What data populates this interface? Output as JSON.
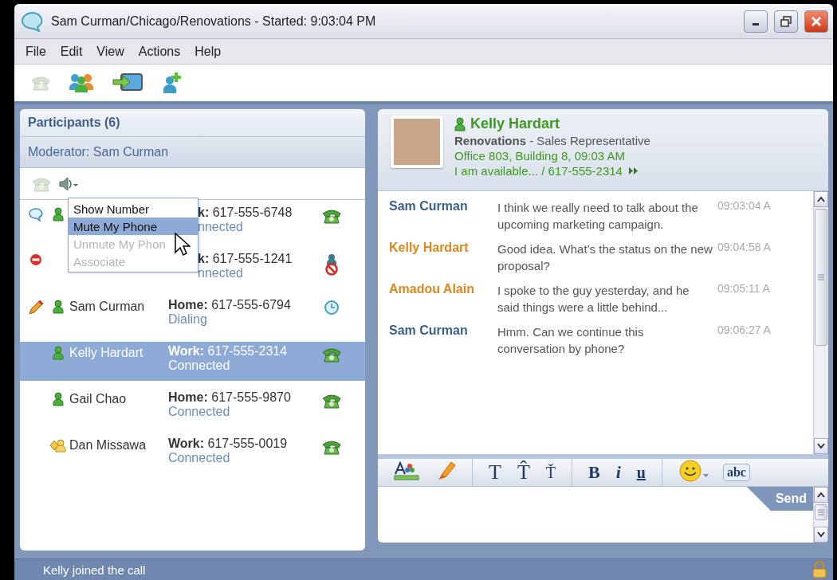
{
  "window": {
    "title": "Sam Curman/Chicago/Renovations - Started: 9:03:04 PM"
  },
  "menu_bar": [
    "File",
    "Edit",
    "View",
    "Actions",
    "Help"
  ],
  "toolbar": [
    {
      "kind": "phone",
      "disabled": true
    },
    {
      "kind": "group",
      "disabled": false
    },
    {
      "kind": "share",
      "disabled": false
    },
    {
      "kind": "add",
      "disabled": false
    }
  ],
  "participants": {
    "title": "Participants (6)",
    "moderator": "Moderator: Sam Curman",
    "rows": [
      {
        "badge": {
          "kind": "chat"
        },
        "presence": {
          "kind": "person"
        },
        "phone_label": "k:",
        "number": "617-555-6748",
        "status": "nnected",
        "call": {
          "kind": "connected"
        },
        "covered": true,
        "selected": false
      },
      {
        "badge": {
          "kind": "stop"
        },
        "phone_label": "k:",
        "number": "617-555-1241",
        "status": "nnected",
        "call": {
          "kind": "blocked"
        },
        "covered": true,
        "selected": false
      },
      {
        "badge": {
          "kind": "edit"
        },
        "presence": {
          "kind": "person"
        },
        "name": "Sam Curman",
        "phone_label": "Home:",
        "number": "617-555-6794",
        "status": "Dialing",
        "call": {
          "kind": "waiting"
        },
        "covered": false,
        "selected": false
      },
      {
        "presence": {
          "kind": "person"
        },
        "name": "Kelly Hardart",
        "phone_label": "Work:",
        "number": "617-555-2314",
        "status": "Connected",
        "call": {
          "kind": "connected"
        },
        "covered": false,
        "selected": true
      },
      {
        "presence": {
          "kind": "person"
        },
        "name": "Gail Chao",
        "phone_label": "Home:",
        "number": "617-555-9870",
        "status": "Connected",
        "call": {
          "kind": "connected"
        },
        "covered": false,
        "selected": false
      },
      {
        "presence": {
          "kind": "group"
        },
        "name": "Dan Missawa",
        "phone_label": "Work:",
        "number": "617-555-0019",
        "status": "Connected",
        "call": {
          "kind": "connected"
        },
        "covered": false,
        "selected": false
      }
    ],
    "menu": [
      {
        "label": "Show Number",
        "selected": false,
        "disabled": false
      },
      {
        "label": "Mute My Phone",
        "selected": true,
        "disabled": false
      },
      {
        "label": "Unmute My Phon",
        "selected": false,
        "disabled": true
      },
      {
        "label": "Associate",
        "selected": false,
        "disabled": true
      }
    ]
  },
  "contact": {
    "name": "Kelly Hardart",
    "title": "**Renovations** - Sales Representative",
    "location": "Office 803, Building 8, 09:03 AM",
    "availability": "I am available... / 617-555-2314"
  },
  "messages": [
    {
      "sender": "Sam Curman",
      "color": "#3b5f8e",
      "text": "I think we really need to talk about the upcoming marketing campaign.",
      "time": "09:03:04 A"
    },
    {
      "sender": "Kelly Hardart",
      "color": "#e0871c",
      "text": "Good idea. What’s the status on the new proposal?",
      "time": "09:04:58 A"
    },
    {
      "sender": "Amadou Alain",
      "color": "#e0871c",
      "text": "I spoke to the guy yesterday, and he said things were a little behind...",
      "time": "09:05:11 A"
    },
    {
      "sender": "Sam Curman",
      "color": "#3b5f8e",
      "text": "Hmm. Can we continue this conversation by phone?",
      "time": "09:06:27 A"
    }
  ],
  "format_tools": [
    {
      "kind": "color"
    },
    {
      "kind": "highlight"
    },
    {
      "kind": "separator"
    },
    {
      "kind": "text",
      "label": "T"
    },
    {
      "kind": "text",
      "label": "T̂"
    },
    {
      "kind": "small",
      "label": "Ť"
    },
    {
      "kind": "separator"
    },
    {
      "kind": "text",
      "label": "B"
    },
    {
      "kind": "italic",
      "label": "i"
    },
    {
      "kind": "underline",
      "label": "u"
    },
    {
      "kind": "separator"
    },
    {
      "kind": "emoji"
    },
    {
      "kind": "spell",
      "label": "abc"
    }
  ],
  "send_button": "Send",
  "status_bar": "Kelly joined the call"
}
